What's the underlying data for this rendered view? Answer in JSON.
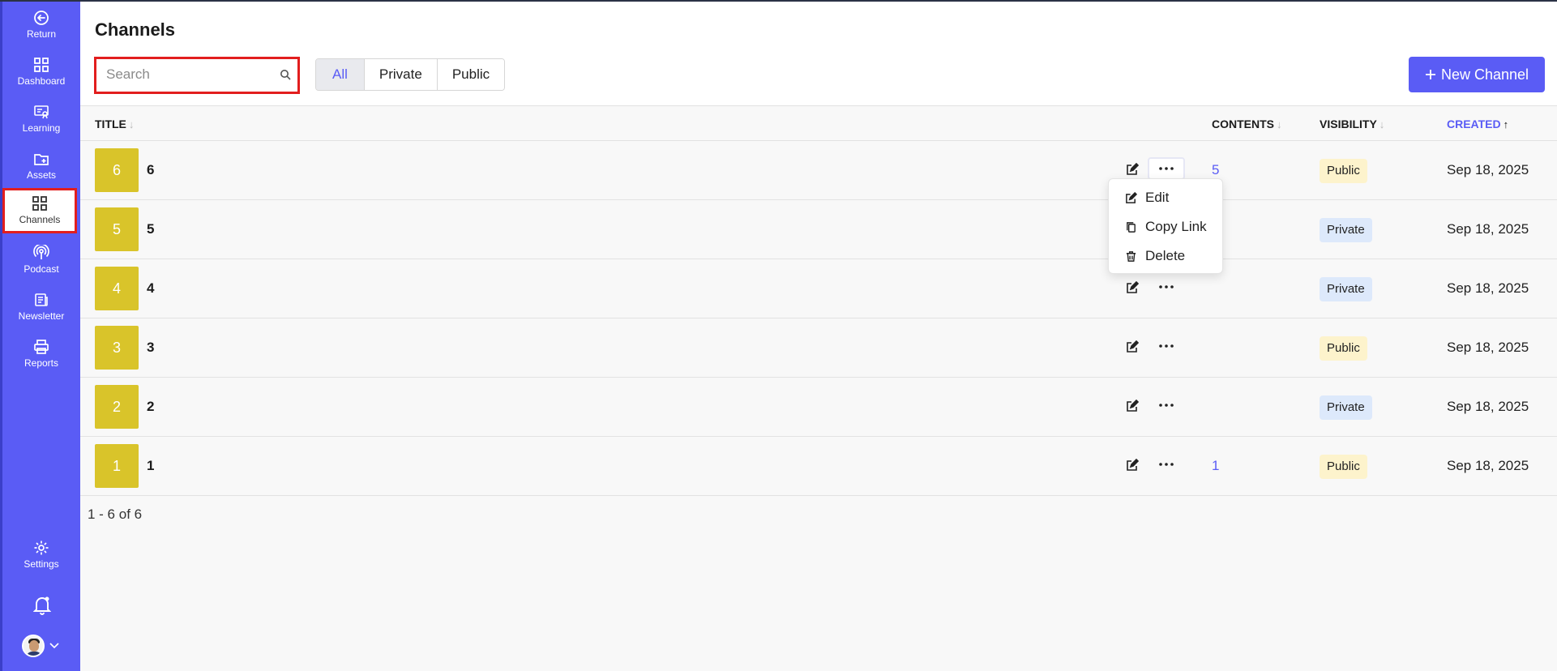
{
  "sidebar": {
    "items": [
      {
        "label": "Return",
        "icon": "return-icon"
      },
      {
        "label": "Dashboard",
        "icon": "dashboard-icon"
      },
      {
        "label": "Learning",
        "icon": "learning-icon"
      },
      {
        "label": "Assets",
        "icon": "assets-folder-icon"
      },
      {
        "label": "Channels",
        "icon": "channels-grid-icon",
        "active": true
      },
      {
        "label": "Podcast",
        "icon": "podcast-icon"
      },
      {
        "label": "Newsletter",
        "icon": "newsletter-icon"
      },
      {
        "label": "Reports",
        "icon": "printer-icon"
      }
    ],
    "settings_label": "Settings"
  },
  "header": {
    "title": "Channels",
    "search_placeholder": "Search",
    "search_value": "",
    "filters": [
      "All",
      "Private",
      "Public"
    ],
    "active_filter": "All",
    "new_button_label": "New Channel"
  },
  "table": {
    "columns": {
      "title": "TITLE",
      "contents": "CONTENTS",
      "visibility": "VISIBILITY",
      "created": "CREATED"
    },
    "sorted_column": "created",
    "rows": [
      {
        "thumb": "6",
        "title": "6",
        "contents": "5",
        "visibility": "Public",
        "created": "Sep 18, 2025"
      },
      {
        "thumb": "5",
        "title": "5",
        "contents": "",
        "visibility": "Private",
        "created": "Sep 18, 2025"
      },
      {
        "thumb": "4",
        "title": "4",
        "contents": "",
        "visibility": "Private",
        "created": "Sep 18, 2025"
      },
      {
        "thumb": "3",
        "title": "3",
        "contents": "",
        "visibility": "Public",
        "created": "Sep 18, 2025"
      },
      {
        "thumb": "2",
        "title": "2",
        "contents": "",
        "visibility": "Private",
        "created": "Sep 18, 2025"
      },
      {
        "thumb": "1",
        "title": "1",
        "contents": "1",
        "visibility": "Public",
        "created": "Sep 18, 2025"
      }
    ],
    "pagination": "1 - 6 of 6"
  },
  "context_menu": {
    "items": [
      {
        "label": "Edit",
        "icon": "edit-icon"
      },
      {
        "label": "Copy Link",
        "icon": "copy-icon"
      },
      {
        "label": "Delete",
        "icon": "trash-icon"
      }
    ]
  },
  "colors": {
    "accent": "#5a5cf5",
    "thumb": "#d9c42a",
    "public_badge": "#fdf3cc",
    "private_badge": "#dde9fb",
    "highlight_border": "#e21e1e"
  }
}
